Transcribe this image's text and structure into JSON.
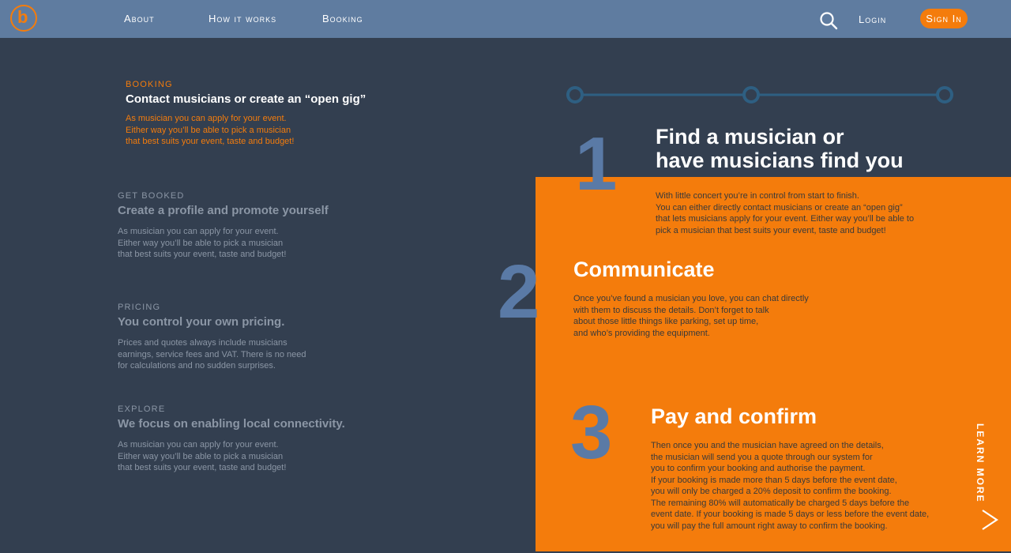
{
  "header": {
    "logo_letter": "b",
    "nav": [
      "About",
      "How it works",
      "Booking"
    ],
    "login": "Login",
    "signin": "Sign In"
  },
  "sections": [
    {
      "kicker": "BOOKING",
      "title": "Contact musicians or create an “open gig”",
      "body": "As musician you can apply for your event.\nEither way you’ll be able to pick a musician\nthat best suits your event, taste and budget!"
    },
    {
      "kicker": "GET BOOKED",
      "title": "Create a profile and promote yourself",
      "body": "As musician you can apply for your event.\nEither way you’ll be able to pick a musician\nthat best suits your event, taste and budget!"
    },
    {
      "kicker": "PRICING",
      "title": "You control your own pricing.",
      "body": "Prices and quotes always include musicians\nearnings, service fees and VAT. There is no need\nfor calculations and no sudden surprises."
    },
    {
      "kicker": "EXPLORE",
      "title": "We focus on enabling local connectivity.",
      "body": "As musician you can apply for your event.\nEither way you’ll be able to pick a musician\nthat best suits your event, taste and budget!"
    }
  ],
  "steps": [
    {
      "number": "1",
      "title": "Find a musician or\nhave musicians find you",
      "body": "With little concert you’re in control from start to finish.\nYou can either directly contact musicians or create an “open gig”\nthat lets musicians apply for your event. Either way you’ll be able to\npick a musician that best suits your event, taste and budget!"
    },
    {
      "number": "2",
      "title": "Communicate",
      "body": "Once you’ve found a musician you love, you can chat directly\n with them to discuss the details. Don’t forget to talk\nabout those little things like parking, set up time,\nand who’s providing the equipment."
    },
    {
      "number": "3",
      "title": "Pay and confirm",
      "body": "Then once you and the musician have agreed on the details,\n the musician will send you a quote through our system for\nyou to confirm your booking and authorise the payment.\nIf your booking is made more than 5 days before the event date,\nyou will only be charged a 20% deposit to confirm the booking.\nThe remaining 80% will automatically be charged 5 days before the\nevent date. If your booking is made 5 days or less before the event date,\nyou will pay the full amount right away to confirm the booking."
    }
  ],
  "learn_more": "LEARN MORE",
  "colors": {
    "background": "#333f50",
    "header": "#5f7ca0",
    "accent": "#f47c0c",
    "number": "#5a7aa6",
    "timeline": "#2e5f82"
  },
  "icons": {
    "search": "search-icon",
    "arrow": "chevron-right-icon"
  }
}
